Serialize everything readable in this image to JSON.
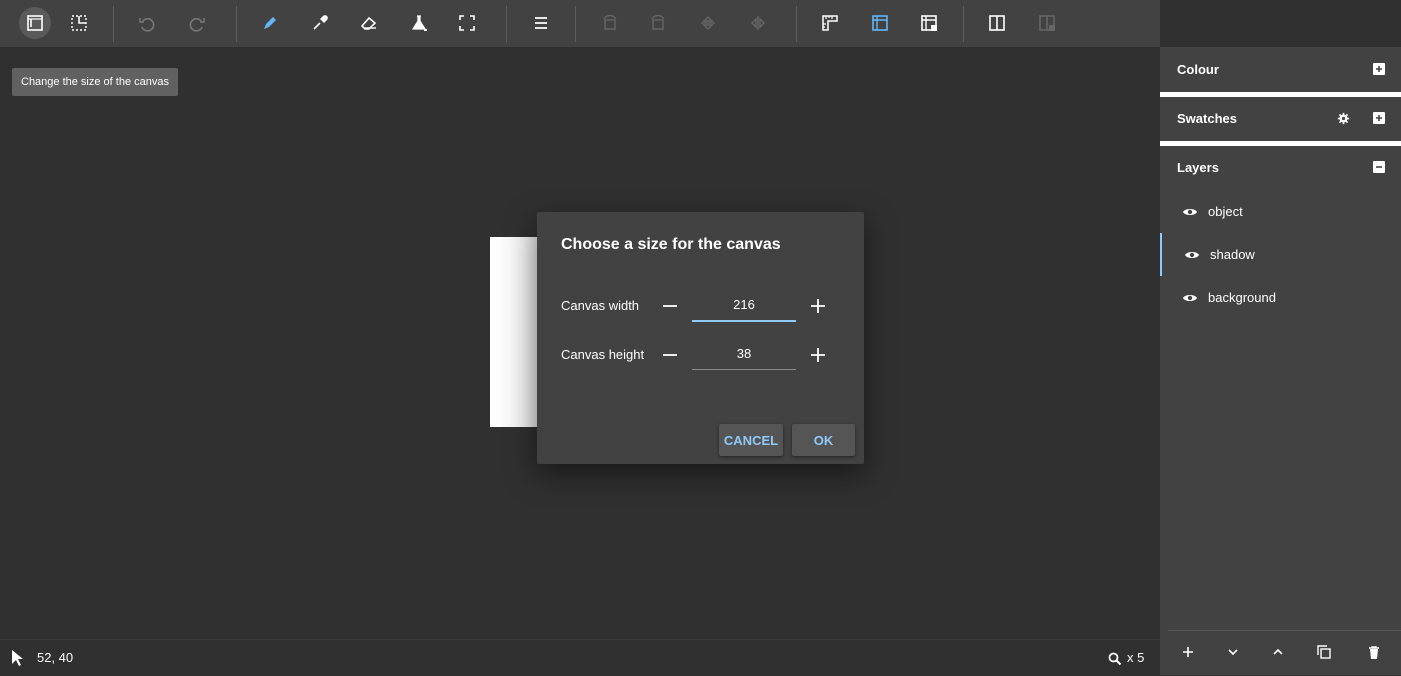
{
  "tooltip": "Change the size of the canvas",
  "dialog": {
    "title": "Choose a size for the canvas",
    "width_label": "Canvas width",
    "width_value": "216",
    "height_label": "Canvas height",
    "height_value": "38",
    "cancel_label": "CANCEL",
    "ok_label": "OK"
  },
  "sidebar": {
    "colour_title": "Colour",
    "swatches_title": "Swatches",
    "layers_title": "Layers",
    "layers": [
      {
        "name": "object"
      },
      {
        "name": "shadow"
      },
      {
        "name": "background"
      }
    ]
  },
  "status": {
    "coords": "52, 40",
    "zoom": "x 5"
  },
  "colors": {
    "accent": "#90caf9",
    "toolbar": "#424242",
    "workspace": "#303030"
  }
}
